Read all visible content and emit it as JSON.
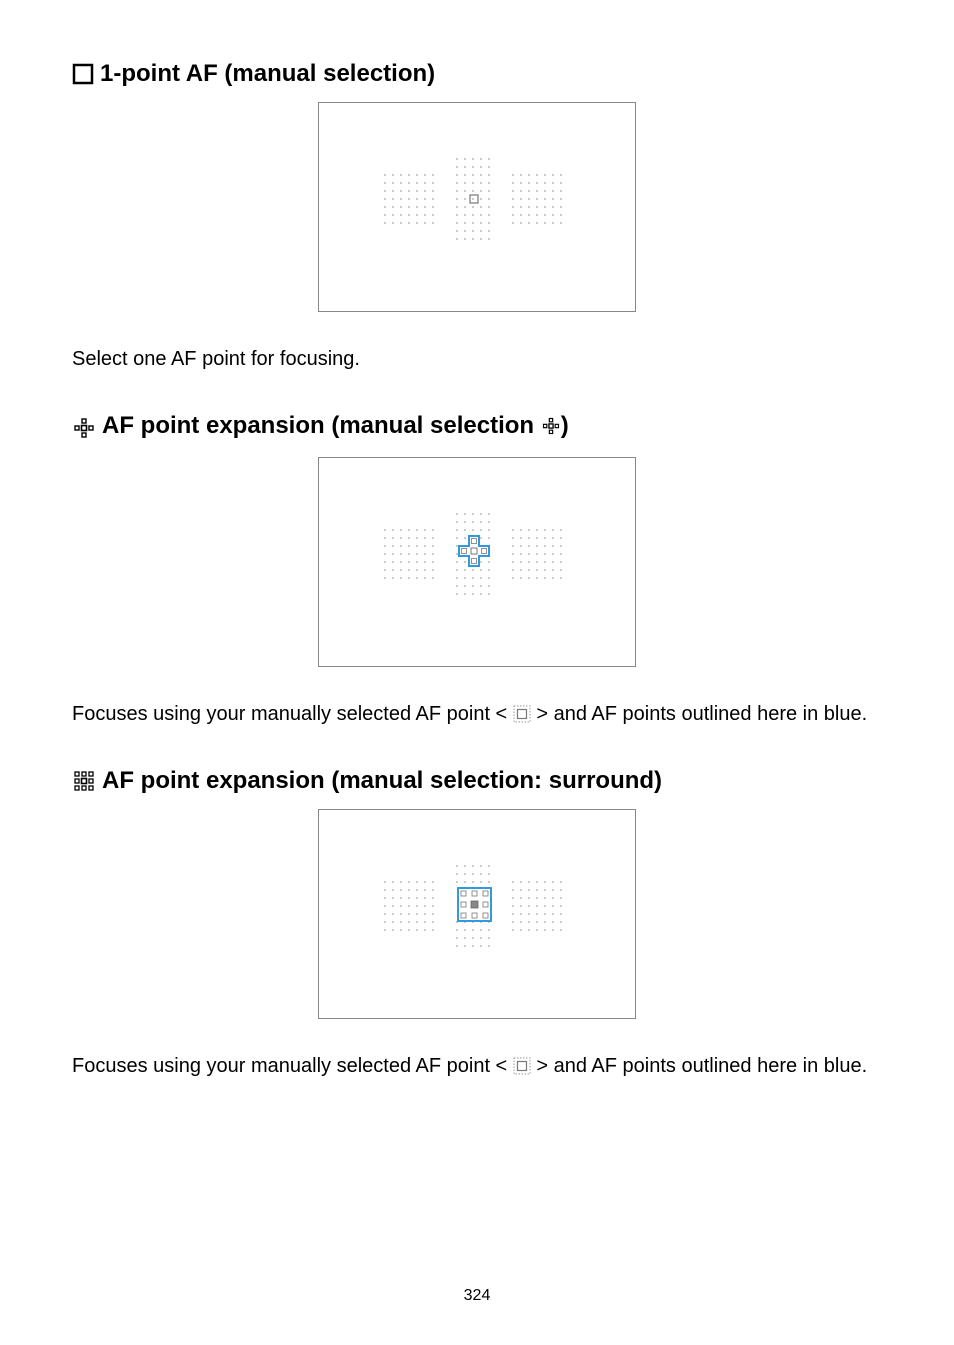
{
  "sections": [
    {
      "icon": "single-point-icon",
      "heading": "1-point AF (manual selection)",
      "diagram": "single",
      "body_prefix": "Select one AF point for focusing.",
      "body_suffix": ""
    },
    {
      "icon": "expand-cross-icon",
      "heading": "AF point expansion (manual selection ",
      "heading_trail_icon": "expand-cross-small-icon",
      "heading_suffix": ")",
      "diagram": "cross",
      "body_prefix": "Focuses using your manually selected AF point < ",
      "body_suffix": " > and AF points outlined here in blue."
    },
    {
      "icon": "expand-surround-icon",
      "heading": "AF point expansion (manual selection: surround)",
      "diagram": "surround",
      "body_prefix": "Focuses using your manually selected AF point < ",
      "body_suffix": " > and AF points outlined here in blue."
    }
  ],
  "page_number": "324"
}
